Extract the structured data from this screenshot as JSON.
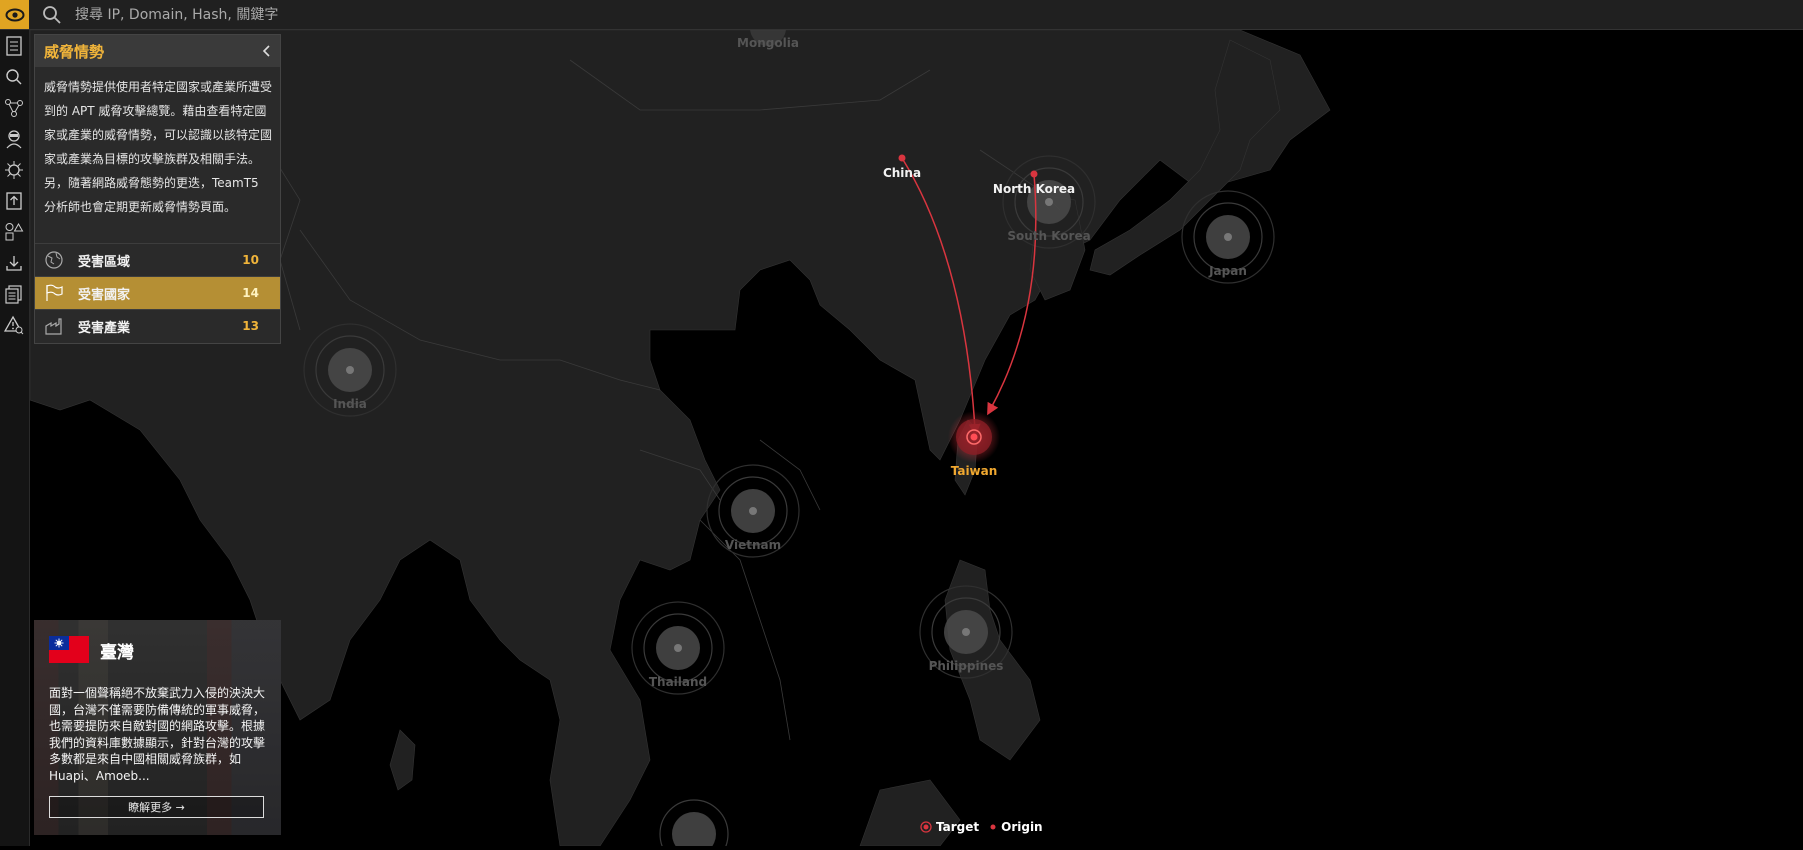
{
  "search": {
    "placeholder": "搜尋 IP, Domain, Hash, 關鍵字"
  },
  "panel": {
    "title": "威脅情勢",
    "description": "威脅情勢提供使用者特定國家或產業所遭受到的 APT 威脅攻擊總覽。藉由查看特定國家或產業的威脅情勢，可以認識以該特定國家或產業為目標的攻擊族群及相關手法。另，隨著網路威脅態勢的更迭，TeamT5 分析師也會定期更新威脅情勢頁面。",
    "stats": [
      {
        "label": "受害區域",
        "count": "10",
        "icon": "globe-icon"
      },
      {
        "label": "受害國家",
        "count": "14",
        "icon": "flag-icon"
      },
      {
        "label": "受害產業",
        "count": "13",
        "icon": "factory-icon"
      }
    ]
  },
  "card": {
    "country": "臺灣",
    "description": "面對一個聲稱絕不放棄武力入侵的泱泱大國，台灣不僅需要防備傳統的軍事威脅，也需要提防來自敵對國的網路攻擊。根據我們的資料庫數據顯示，針對台灣的攻擊多數都是來自中國相關威脅族群，如 Huapi、Amoeb...",
    "more_label": "瞭解更多 →"
  },
  "map": {
    "target_color": "#d9353f",
    "label_target_color": "#f0a830",
    "labels": {
      "mongolia": "Mongolia",
      "china": "China",
      "north_korea": "North Korea",
      "south_korea": "South Korea",
      "japan": "Japan",
      "india": "India",
      "taiwan": "Taiwan",
      "vietnam": "Vietnam",
      "thailand": "Thailand",
      "philippines": "Philippines"
    }
  },
  "legend": {
    "target": "Target",
    "origin": "Origin"
  }
}
